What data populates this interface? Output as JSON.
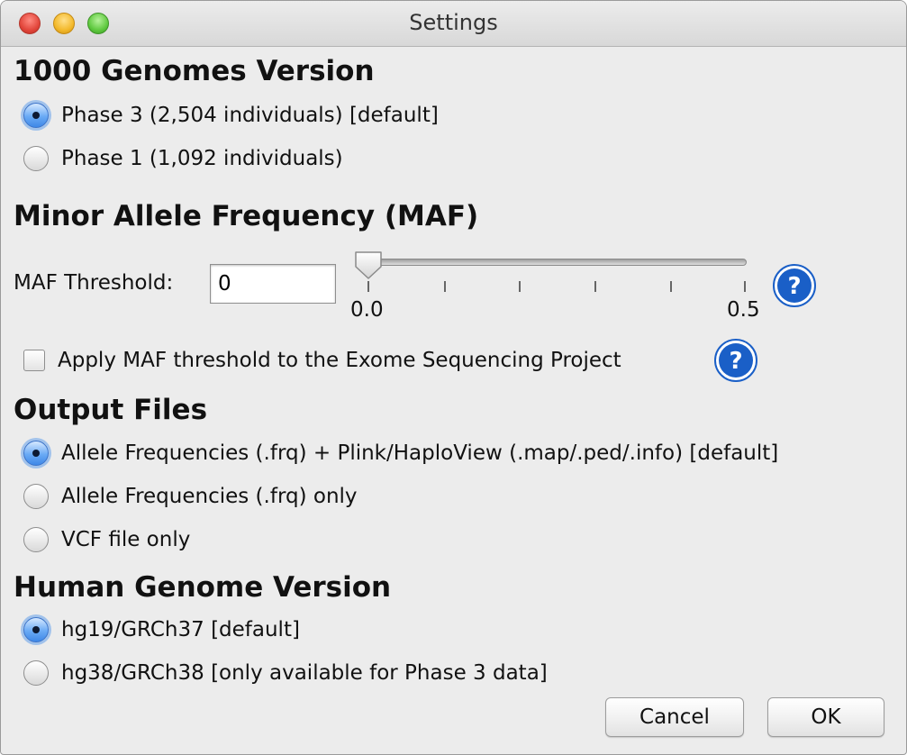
{
  "window": {
    "title": "Settings"
  },
  "genomes": {
    "heading": "1000 Genomes Version",
    "options": [
      {
        "label": "Phase 3 (2,504 individuals) [default]",
        "selected": true
      },
      {
        "label": "Phase 1 (1,092 individuals)",
        "selected": false
      }
    ]
  },
  "maf": {
    "heading": "Minor Allele Frequency (MAF)",
    "threshold_label": "MAF Threshold:",
    "threshold_value": "0",
    "slider": {
      "min_label": "0.0",
      "max_label": "0.5",
      "value": 0.0
    },
    "apply_esp_label": "Apply MAF threshold to the Exome Sequencing Project",
    "apply_esp_checked": false
  },
  "output": {
    "heading": "Output Files",
    "options": [
      {
        "label": "Allele Frequencies (.frq) + Plink/HaploView (.map/.ped/.info) [default]",
        "selected": true
      },
      {
        "label": "Allele Frequencies (.frq) only",
        "selected": false
      },
      {
        "label": "VCF file only",
        "selected": false
      }
    ]
  },
  "human_genome": {
    "heading": "Human Genome Version",
    "options": [
      {
        "label": "hg19/GRCh37 [default]",
        "selected": true
      },
      {
        "label": "hg38/GRCh38 [only available for Phase 3 data]",
        "selected": false
      }
    ]
  },
  "buttons": {
    "cancel": "Cancel",
    "ok": "OK"
  },
  "icons": {
    "help": "help-icon",
    "thumb": "slider-thumb"
  },
  "colors": {
    "accent": "#3f88e7",
    "help_blue": "#1a5fc7"
  }
}
